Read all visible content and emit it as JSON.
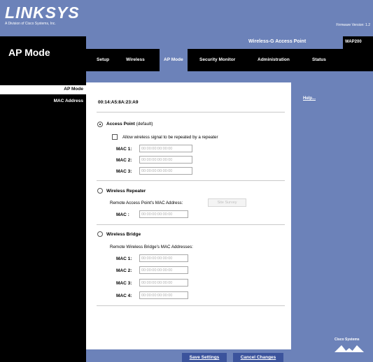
{
  "header": {
    "logo": "LINKSYS",
    "logo_sub": "A Division of Cisco Systems, Inc.",
    "firmware": "Firmware Version: 1.2",
    "page_title": "AP Mode",
    "product_name": "Wireless-G Access Point",
    "model": "WAP200"
  },
  "tabs": [
    {
      "label": "Setup",
      "active": false
    },
    {
      "label": "Wireless",
      "active": false
    },
    {
      "label": "AP Mode",
      "active": true
    },
    {
      "label": "Security Monitor",
      "active": false
    },
    {
      "label": "Administration",
      "active": false
    },
    {
      "label": "Status",
      "active": false
    }
  ],
  "sidebar": {
    "section": "AP Mode",
    "mac_label": "MAC Address"
  },
  "main": {
    "mac_address": "00:14:A5:8A:23:A9",
    "access_point": {
      "label": "Access Point",
      "note": "(default)",
      "selected": true,
      "allow_repeat": "Allow wireless signal to be repeated by a repeater",
      "macs": [
        {
          "label": "MAC 1:",
          "placeholder": "00:00:00:00:00:00"
        },
        {
          "label": "MAC 2:",
          "placeholder": "00:00:00:00:00:00"
        },
        {
          "label": "MAC 3:",
          "placeholder": "00:00:00:00:00:00"
        }
      ]
    },
    "repeater": {
      "label": "Wireless Repeater",
      "remote_label": "Remote Access Point's MAC Address:",
      "site_survey": "Site Survey",
      "mac_label": "MAC :",
      "placeholder": "00:00:00:00:00:00"
    },
    "bridge": {
      "label": "Wireless Bridge",
      "remote_label": "Remote Wireless Bridge's MAC Addresses:",
      "macs": [
        {
          "label": "MAC 1:",
          "placeholder": "00:00:00:00:00:00"
        },
        {
          "label": "MAC 2:",
          "placeholder": "00:00:00:00:00:00"
        },
        {
          "label": "MAC 3:",
          "placeholder": "00:00:00:00:00:00"
        },
        {
          "label": "MAC 4:",
          "placeholder": "00:00:00:00:00:00"
        }
      ]
    }
  },
  "help": {
    "label": "Help..."
  },
  "brand": {
    "cisco": "Cisco Systems"
  },
  "footer": {
    "save": "Save Settings",
    "cancel": "Cancel Changes"
  },
  "colors": {
    "accent": "#6c82b9",
    "dark": "#000000"
  }
}
